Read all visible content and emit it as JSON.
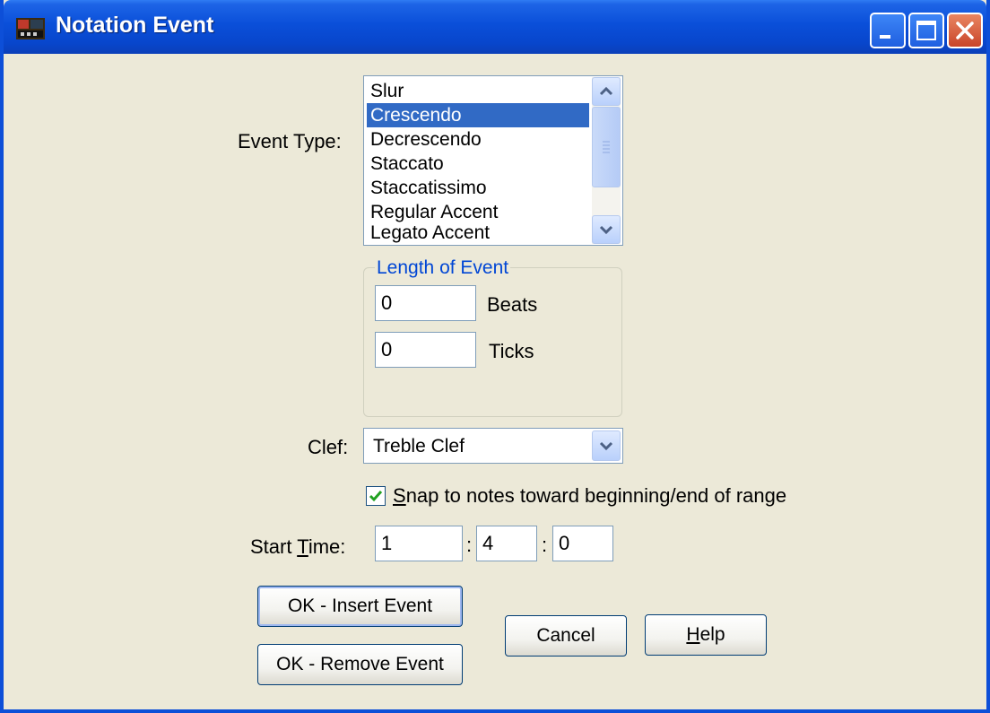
{
  "window": {
    "title": "Notation Event"
  },
  "event_type": {
    "label": "Event Type:",
    "items": [
      "Slur",
      "Crescendo",
      "Decrescendo",
      "Staccato",
      "Staccatissimo",
      "Regular Accent",
      "Legato Accent"
    ],
    "selected": "Crescendo"
  },
  "length_of_event": {
    "title": "Length of Event",
    "beats_value": "0",
    "beats_label": "Beats",
    "ticks_value": "0",
    "ticks_label": "Ticks"
  },
  "clef": {
    "label": "Clef:",
    "selected": "Treble Clef"
  },
  "snap": {
    "checked": true,
    "label_first": "S",
    "label_rest": "nap to notes toward beginning/end of range"
  },
  "start_time": {
    "label_pre": "Start ",
    "label_u": "T",
    "label_post": "ime:",
    "bar": "1",
    "beat": "4",
    "tick": "0",
    "separator": ":"
  },
  "buttons": {
    "insert": "OK - Insert Event",
    "remove": "OK - Remove Event",
    "cancel": "Cancel",
    "help_u": "H",
    "help_rest": "elp"
  },
  "colors": {
    "titlebar": "#0a4fd9",
    "dialog_bg": "#ece9d8",
    "selection": "#316ac5",
    "group_title": "#0046d5"
  }
}
